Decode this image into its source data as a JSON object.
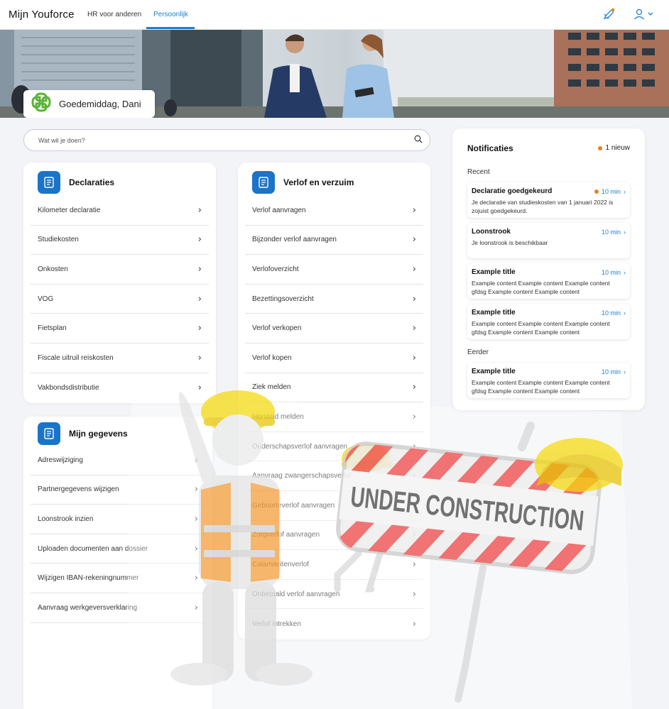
{
  "nav": {
    "brand": "Mijn  Youforce",
    "tabs": [
      {
        "label": "HR voor anderen",
        "active": false
      },
      {
        "label": "Persoonlijk",
        "active": true
      }
    ]
  },
  "hero": {
    "greeting": "Goedemiddag, Dani"
  },
  "search": {
    "placeholder": "Wat wil je doen?"
  },
  "cards": {
    "declaraties": {
      "title": "Declaraties",
      "items": [
        "Kilometer declaratie",
        "Studiekosten",
        "Onkosten",
        "VOG",
        "Fietsplan",
        "Fiscale uitruil reiskosten",
        "Vakbondsdistributie"
      ]
    },
    "verlof": {
      "title": "Verlof en verzuim",
      "items": [
        "Verlof aanvragen",
        "Bijzonder verlof aanvragen",
        "Verlofoverzicht",
        "Bezettingsoverzicht",
        "Verlof verkopen",
        "Verlof kopen",
        "Ziek melden",
        "Hersteld melden",
        "Ouderschapsverlof aanvragen",
        "Aanvraag zwangerschapsverlof",
        "Geboorteverlof aanvragen",
        "Zorgverlof aanvragen",
        "Calamiteitenverlof",
        "Onbetaald verlof aanvragen",
        "Verlof intrekken"
      ]
    },
    "gegevens": {
      "title": "Mijn gegevens",
      "items": [
        "Adreswijziging",
        "Partnergegevens wijzigen",
        "Loonstrook inzien",
        "Uploaden documenten aan dossier",
        "Wijzigen IBAN-rekeningnummer",
        "Aanvraag werkgeversverklaring"
      ]
    }
  },
  "notifications": {
    "title": "Notificaties",
    "new_label": "1 nieuw",
    "recent_label": "Recent",
    "earlier_label": "Eerder",
    "recent": [
      {
        "title": "Declaratie goedgekeurd",
        "time": "10 min",
        "unread": true,
        "body": "Je declaratie van studieskosten van 1 januari 2022 is zojuist goedgekeurd."
      },
      {
        "title": "Loonstrook",
        "time": "10 min",
        "unread": false,
        "body": "Je loonstrook is beschikbaar"
      },
      {
        "title": "Example title",
        "time": "10 min",
        "unread": false,
        "body": "Example content Example content Example content gfdsg Example content Example content"
      },
      {
        "title": "Example title",
        "time": "10 min",
        "unread": false,
        "body": "Example content Example content Example content gfdsg Example content Example content"
      }
    ],
    "earlier": [
      {
        "title": "Example title",
        "time": "10 min",
        "unread": false,
        "body": "Example content Example content Example content gfdsg Example content Example content"
      }
    ]
  },
  "overlay": {
    "sign_text": "UNDER CONSTRUCTION"
  },
  "colors": {
    "accent": "#1a7fd4",
    "icon_bg": "#1a74c9",
    "unread_dot": "#e8821e",
    "logo_green": "#5cb33a"
  }
}
